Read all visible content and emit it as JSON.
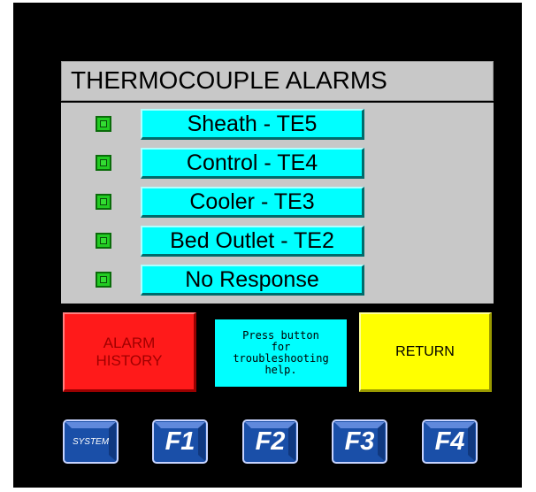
{
  "screen": {
    "title": "THERMOCOUPLE ALARMS"
  },
  "alarms": [
    {
      "label": "Sheath - TE5",
      "indicator": "green"
    },
    {
      "label": "Control - TE4",
      "indicator": "green"
    },
    {
      "label": "Cooler - TE3",
      "indicator": "green"
    },
    {
      "label": "Bed Outlet - TE2",
      "indicator": "green"
    },
    {
      "label": "No Response",
      "indicator": "green"
    }
  ],
  "buttons": {
    "alarm_history": "ALARM\nHISTORY",
    "help_text": "Press button\nfor\ntroubleshooting\nhelp.",
    "return": "RETURN"
  },
  "function_keys": [
    "SYSTEM",
    "F1",
    "F2",
    "F3",
    "F4"
  ],
  "colors": {
    "panel_bg": "#000000",
    "area_bg": "#c8c8c8",
    "alarm_button": "#00ffff",
    "indicator_ok": "#22cc22",
    "alarm_history": "#ff1a1a",
    "return": "#ffff00",
    "fkey": "#1a4fa8"
  }
}
